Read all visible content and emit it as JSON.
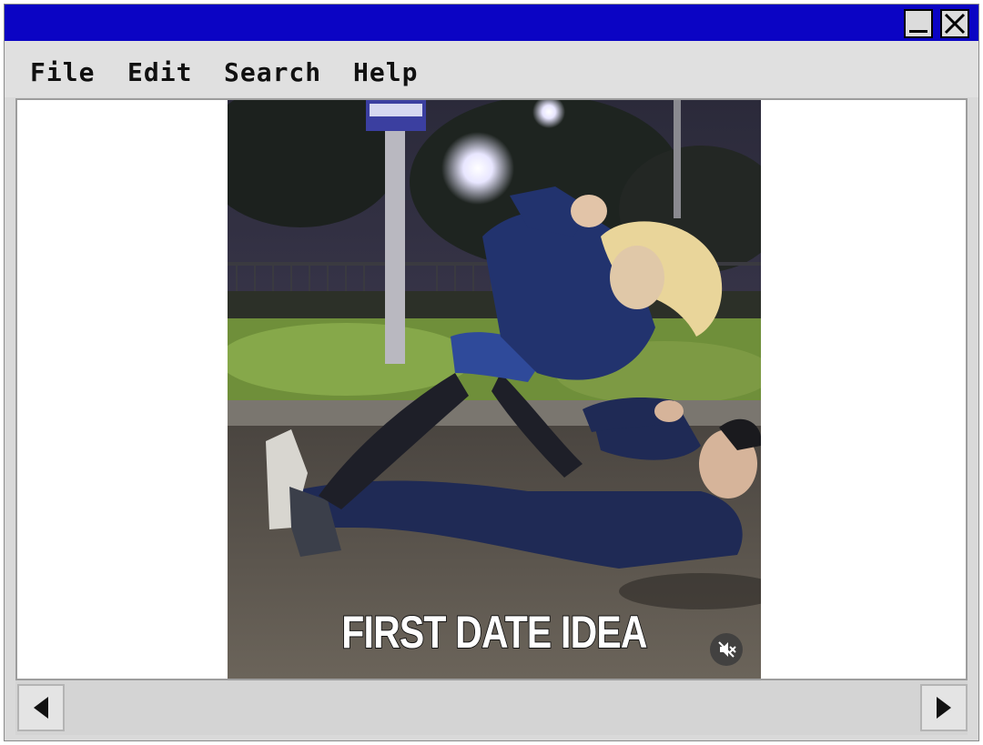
{
  "window": {
    "title_color": "#0b04c4",
    "controls": [
      {
        "name": "minimize",
        "icon": "minimize-icon"
      },
      {
        "name": "close",
        "icon": "close-icon"
      }
    ]
  },
  "menu": {
    "items": [
      {
        "label": "File"
      },
      {
        "label": "Edit"
      },
      {
        "label": "Search"
      },
      {
        "label": "Help"
      }
    ]
  },
  "media": {
    "caption": "FIRST DATE IDEA",
    "mute_icon": "muted-speaker-icon"
  },
  "scrollbar": {
    "left_icon": "arrow-left-icon",
    "right_icon": "arrow-right-icon"
  }
}
